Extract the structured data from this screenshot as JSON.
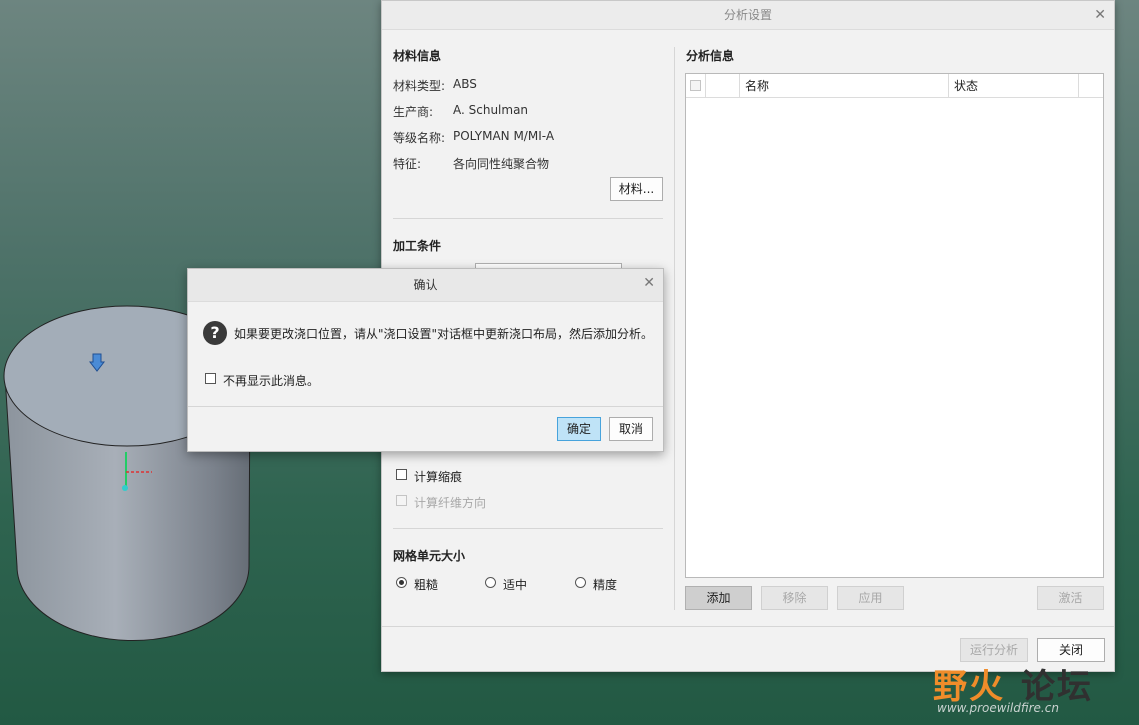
{
  "colors": {
    "accent": "#47a3dc",
    "primary_button_bg": "#bfe3f7",
    "watermark_orange": "#f08c2a",
    "watermark_dark": "#303030"
  },
  "main_dialog": {
    "title": "分析设置",
    "close_icon": "close-icon",
    "material": {
      "section_title": "材料信息",
      "type_label": "材料类型:",
      "type_value": "ABS",
      "maker_label": "生产商:",
      "maker_value": "A. Schulman",
      "grade_label": "等级名称:",
      "grade_value": "POLYMAN M/MI-A",
      "feature_label": "特征:",
      "feature_value": "各向同性纯聚合物",
      "material_button": "材料..."
    },
    "process": {
      "section_title": "加工条件",
      "options": [
        {
          "label": "计算缩痕",
          "checked": false,
          "disabled": false
        },
        {
          "label": "计算纤维方向",
          "checked": false,
          "disabled": true
        }
      ]
    },
    "mesh": {
      "section_title": "网格单元大小",
      "options": [
        {
          "label": "粗糙",
          "checked": true
        },
        {
          "label": "适中",
          "checked": false
        },
        {
          "label": "精度",
          "checked": false
        }
      ]
    },
    "analysis": {
      "section_title": "分析信息",
      "columns": [
        "名称",
        "状态"
      ],
      "buttons": {
        "add": "添加",
        "remove": "移除",
        "apply": "应用",
        "activate": "激活"
      }
    },
    "footer": {
      "run": "运行分析",
      "close": "关闭"
    }
  },
  "confirm_dialog": {
    "title": "确认",
    "message": "如果要更改浇口位置，请从\"浇口设置\"对话框中更新浇口布局，然后添加分析。",
    "icon": "question-icon",
    "dont_show": "不再显示此消息。",
    "ok": "确定",
    "cancel": "取消"
  },
  "watermark": {
    "brand_part1": "野火",
    "brand_part2": "论坛",
    "url": "www.proewildfire.cn"
  }
}
